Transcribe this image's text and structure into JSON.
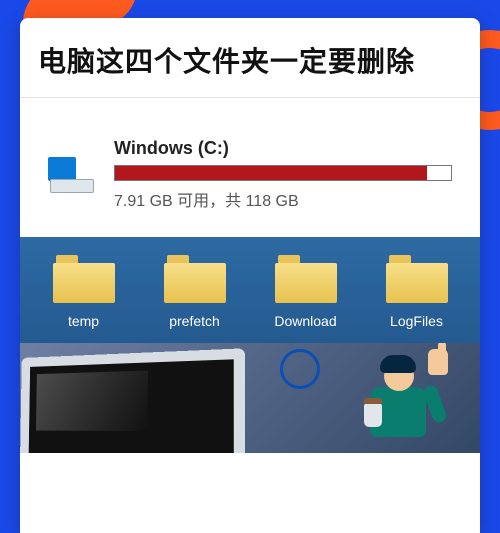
{
  "headline": "电脑这四个文件夹一定要删除",
  "drive": {
    "name": "Windows (C:)",
    "used_percent": 93,
    "status": "7.91 GB 可用，共 118 GB"
  },
  "folders": [
    {
      "label": "temp"
    },
    {
      "label": "prefetch"
    },
    {
      "label": "Download"
    },
    {
      "label": "LogFiles"
    }
  ]
}
